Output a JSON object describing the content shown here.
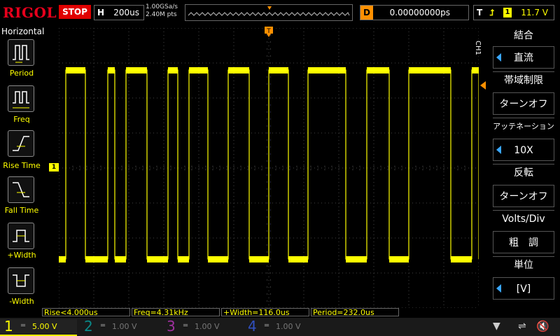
{
  "header": {
    "logo": "RIGOL",
    "run_state": "STOP",
    "timebase_key": "H",
    "timebase_value": "200us",
    "sample_rate": "1.00GSa/s",
    "memory_depth": "2.40M pts",
    "delay_key": "D",
    "delay_value": "0.00000000ps",
    "trigger_key": "T",
    "trigger_source_badge": "1",
    "trigger_level": "11.7 V"
  },
  "left_panel": {
    "title": "Horizontal",
    "items": [
      {
        "label": "Period",
        "icon": "period-icon"
      },
      {
        "label": "Freq",
        "icon": "frequency-icon"
      },
      {
        "label": "Rise Time",
        "icon": "rise-time-icon"
      },
      {
        "label": "Fall Time",
        "icon": "fall-time-icon"
      },
      {
        "label": "+Width",
        "icon": "positive-width-icon"
      },
      {
        "label": "-Width",
        "icon": "negative-width-icon"
      }
    ]
  },
  "right_panel": {
    "channel_label": "CH1",
    "items": [
      {
        "label": "結合",
        "value": "直流"
      },
      {
        "label": "帯域制限",
        "value": "ターンオフ"
      },
      {
        "label": "アッテネーション",
        "value": "10X"
      },
      {
        "label": "反転",
        "value": "ターンオフ"
      },
      {
        "label": "Volts/Div",
        "value": "粗　調"
      },
      {
        "label": "単位",
        "value": "[V]"
      }
    ]
  },
  "measurements": {
    "rise": "Rise<4.000us",
    "freq": "Freq=4.31kHz",
    "pwidth": "+Width=116.0us",
    "period": "Period=232.0us"
  },
  "channels": [
    {
      "num": "1",
      "scale": "5.00 V",
      "color": "#ffff00"
    },
    {
      "num": "2",
      "scale": "1.00 V",
      "color": "#00c8c8"
    },
    {
      "num": "3",
      "scale": "1.00 V",
      "color": "#e040e0"
    },
    {
      "num": "4",
      "scale": "1.00 V",
      "color": "#3070ff"
    }
  ],
  "ch1_ground_marker": "1",
  "trace_color": "#ffff00",
  "accent_blue": "#3aa8ff",
  "accent_orange": "#ff9000"
}
